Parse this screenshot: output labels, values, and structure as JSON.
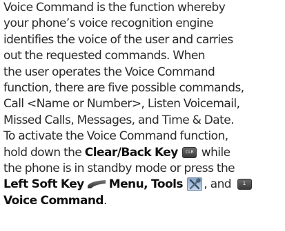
{
  "text": {
    "line1": "Voice Command is the function whereby",
    "line2": "your phone’s voice recognition engine",
    "line3": "identifies the voice of the user and carries",
    "line4": "out the requested commands. When",
    "line5": "the user operates the Voice Command",
    "line6": "function, there are five  possible commands,",
    "line7": "Call <Name or Number>, Listen Voicemail,",
    "line8": "Missed Calls, Messages, and Time & Date.",
    "line9": "To activate the Voice Command function,",
    "line10_pre": "hold down the ",
    "line10_bold": "Clear/Back Key",
    "line10_post": " while",
    "line11": "the phone is in standby mode or press the",
    "line12_bold1": "Left Soft Key",
    "line12_bold2": "Menu, Tools",
    "line12_post": ", and",
    "line13_bold": "Voice Command",
    "line13_post": "."
  },
  "icons": {
    "clear_key": {
      "name": "clear-back-key-icon",
      "label": "CLR"
    },
    "left_soft_key": {
      "name": "left-soft-key-icon"
    },
    "tools": {
      "name": "tools-icon"
    },
    "one_key": {
      "name": "one-key-icon",
      "label": "1"
    }
  },
  "colors": {
    "text": "#2a2a2a",
    "bold_text": "#111111",
    "key_dark": "#3a3a3a",
    "tools_blue": "#8aa7c8"
  }
}
